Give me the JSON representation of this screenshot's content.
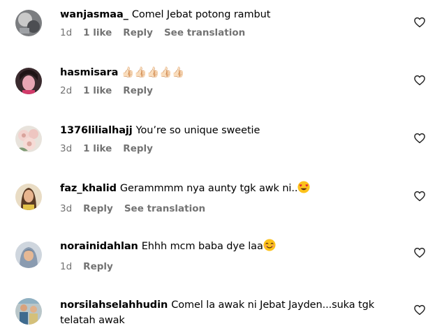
{
  "comments": [
    {
      "username": "wanjasmaa_",
      "text": "Comel Jebat potong rambut",
      "time": "1d",
      "likes": "1 like",
      "reply": "Reply",
      "translate": "See translation"
    },
    {
      "username": "hasmisara",
      "text": "👍🏻👍🏻👍🏻👍🏻👍🏻",
      "time": "2d",
      "likes": "1 like",
      "reply": "Reply"
    },
    {
      "username": "1376lilialhajj",
      "text": "You’re so unique sweetie",
      "time": "3d",
      "likes": "1 like",
      "reply": "Reply"
    },
    {
      "username": "faz_khalid",
      "text": "Gerammmm nya aunty tgk awk ni..",
      "time": "3d",
      "reply": "Reply",
      "translate": "See translation"
    },
    {
      "username": "norainidahlan",
      "text": "Ehhh mcm baba dye laa",
      "time": "1d",
      "reply": "Reply"
    },
    {
      "username": "norsilahselahhudin",
      "text": "Comel la awak ni Jebat Jayden...suka tgk telatah awak"
    }
  ],
  "icons": {
    "like": "heart-outline-icon",
    "heart_eyes": "heart-eyes-emoji",
    "smile": "smiling-face-emoji"
  },
  "colors": {
    "meta": "#737373",
    "text": "#000000",
    "background": "#ffffff"
  }
}
